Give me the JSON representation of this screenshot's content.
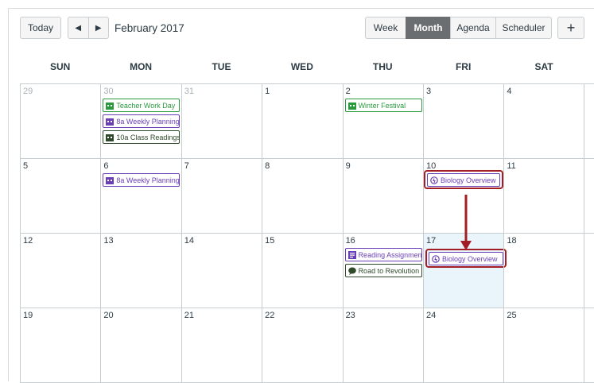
{
  "toolbar": {
    "today_label": "Today",
    "prev_icon": "caret-left-icon",
    "next_icon": "caret-right-icon",
    "month_title": "February 2017",
    "views": [
      "Week",
      "Month",
      "Agenda",
      "Scheduler"
    ],
    "active_view": "Month",
    "add_label": "+"
  },
  "weekdays": [
    "SUN",
    "MON",
    "TUE",
    "WED",
    "THU",
    "FRI",
    "SAT"
  ],
  "weeks": [
    [
      "29",
      "30",
      "31",
      "1",
      "2",
      "3",
      "4"
    ],
    [
      "5",
      "6",
      "7",
      "8",
      "9",
      "10",
      "11"
    ],
    [
      "12",
      "13",
      "14",
      "15",
      "16",
      "17",
      "18"
    ],
    [
      "19",
      "20",
      "21",
      "22",
      "23",
      "24",
      "25"
    ]
  ],
  "events": {
    "teacher_work_day": "Teacher Work Day",
    "weekly_planning_30": "8a Weekly Planning",
    "class_readings": "10a Class Readings",
    "winter_festival": "Winter Festival",
    "weekly_planning_6": "8a Weekly Planning",
    "biology_overview_10": "Biology Overview",
    "reading_assignment": "Reading Assignment",
    "road_to_revolution": "Road to Revolution",
    "biology_overview_17": "Biology Overview"
  },
  "colors": {
    "green_event": "#2a9a3f",
    "purple_event": "#6a3fb5",
    "dark_event": "#2f4a2a",
    "callout": "#a31d25",
    "highlight_day": "#e9f4fb",
    "active_view_bg": "#6b6e70"
  }
}
